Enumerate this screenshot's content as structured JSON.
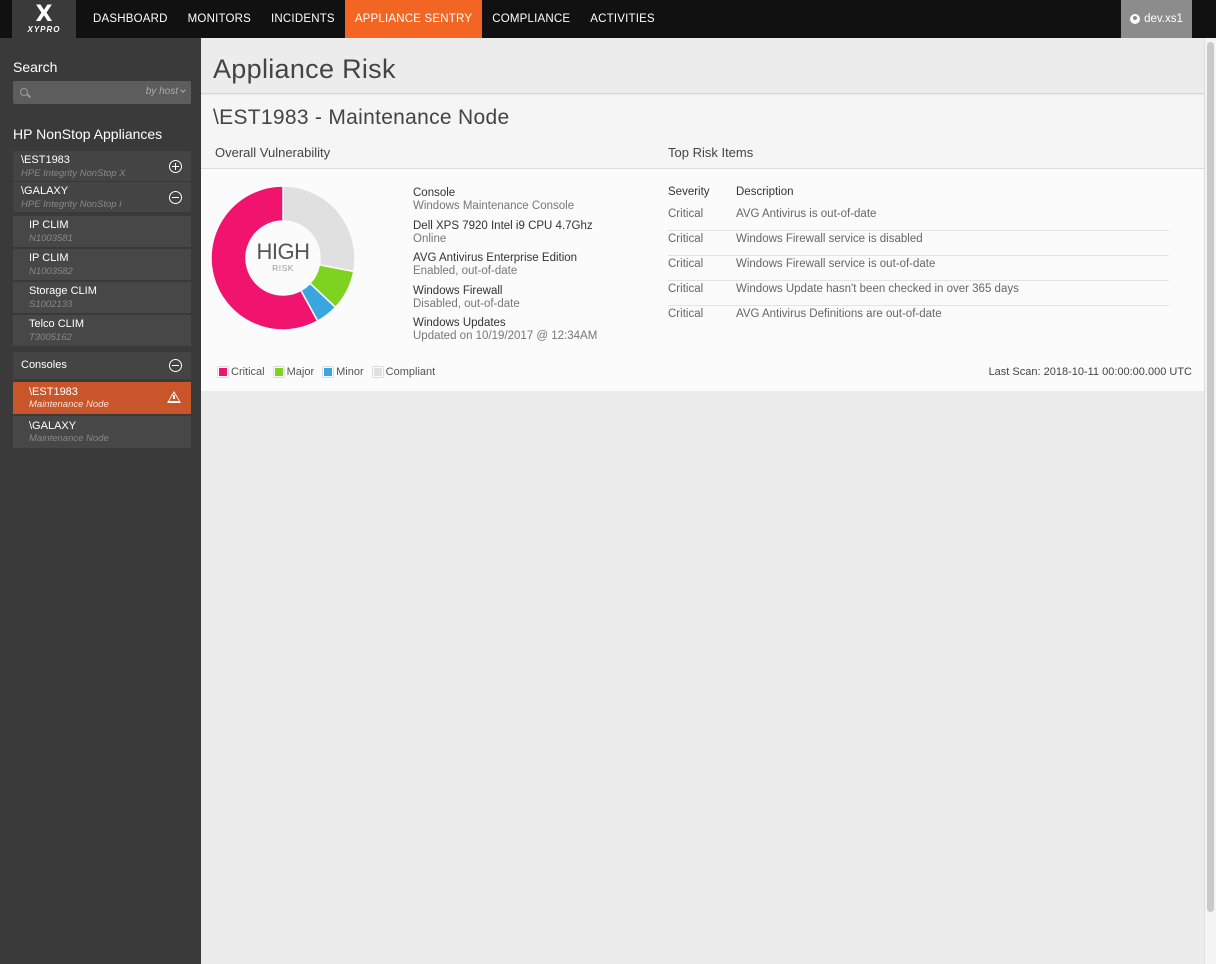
{
  "brand": {
    "logo_mark": "X",
    "logo_text": "XYPRO"
  },
  "nav": {
    "items": [
      {
        "label": "DASHBOARD"
      },
      {
        "label": "MONITORS"
      },
      {
        "label": "INCIDENTS"
      },
      {
        "label": "APPLIANCE SENTRY",
        "active": true
      },
      {
        "label": "COMPLIANCE"
      },
      {
        "label": "ACTIVITIES"
      }
    ],
    "user": "dev.xs1",
    "accent_color": "#f26522"
  },
  "sidebar": {
    "search_title": "Search",
    "search_placeholder": "",
    "search_mode": "by host",
    "section_title": "HP NonStop Appliances",
    "nodes": [
      {
        "name": "\\EST1983",
        "sub": "HPE Integrity NonStop X",
        "toggle": "plus-circle-icon"
      },
      {
        "name": "\\GALAXY",
        "sub": "HPE Integrity NonStop i",
        "toggle": "minus-circle-icon"
      }
    ],
    "children": [
      {
        "name": "IP CLIM",
        "sub": "N1003581"
      },
      {
        "name": "IP CLIM",
        "sub": "N1003582"
      },
      {
        "name": "Storage CLIM",
        "sub": "S1002133"
      },
      {
        "name": "Telco CLIM",
        "sub": "T3005162"
      }
    ],
    "consoles": {
      "label": "Consoles",
      "items": [
        {
          "name": "\\EST1983",
          "sub": "Maintenance Node",
          "active": true,
          "icon": "warning-icon"
        },
        {
          "name": "\\GALAXY",
          "sub": "Maintenance Node",
          "active": false
        }
      ]
    }
  },
  "main": {
    "page_title": "Appliance Risk",
    "node_title": "\\EST1983 - Maintenance Node",
    "overall_heading": "Overall Vulnerability",
    "top_risk_heading": "Top Risk Items",
    "risk_level": "HIGH",
    "risk_word": "RISK",
    "details": [
      {
        "title": "Console",
        "sub": "Windows Maintenance Console"
      },
      {
        "title": "Dell XPS 7920 Intel i9 CPU 4.7Ghz",
        "sub": "Online"
      },
      {
        "title": "AVG Antivirus Enterprise Edition",
        "sub": "Enabled, out-of-date"
      },
      {
        "title": "Windows Firewall",
        "sub": "Disabled, out-of-date"
      },
      {
        "title": "Windows Updates",
        "sub": "Updated on 10/19/2017 @ 12:34AM"
      }
    ],
    "risk_table": {
      "headers": [
        "Severity",
        "Description"
      ],
      "rows": [
        [
          "Critical",
          "AVG Antivirus is out-of-date"
        ],
        [
          "Critical",
          "Windows Firewall service is disabled"
        ],
        [
          "Critical",
          "Windows Firewall service is out-of-date"
        ],
        [
          "Critical",
          "Windows Update hasn't been checked in over 365 days"
        ],
        [
          "Critical",
          "AVG Antivirus Definitions are out-of-date"
        ]
      ]
    },
    "legend": [
      {
        "label": "Critical",
        "color": "#f0146e"
      },
      {
        "label": "Major",
        "color": "#7ed321"
      },
      {
        "label": "Minor",
        "color": "#3aa6df"
      },
      {
        "label": "Compliant",
        "color": "#e0e0e0"
      }
    ],
    "last_scan": "Last Scan: 2018-10-11 00:00:00.000 UTC"
  },
  "chart_data": {
    "type": "pie",
    "categories": [
      "Critical",
      "Major",
      "Minor",
      "Compliant"
    ],
    "values": [
      58,
      9,
      5,
      28
    ],
    "colors": [
      "#f0146e",
      "#7ed321",
      "#3aa6df",
      "#e0e0e0"
    ]
  }
}
